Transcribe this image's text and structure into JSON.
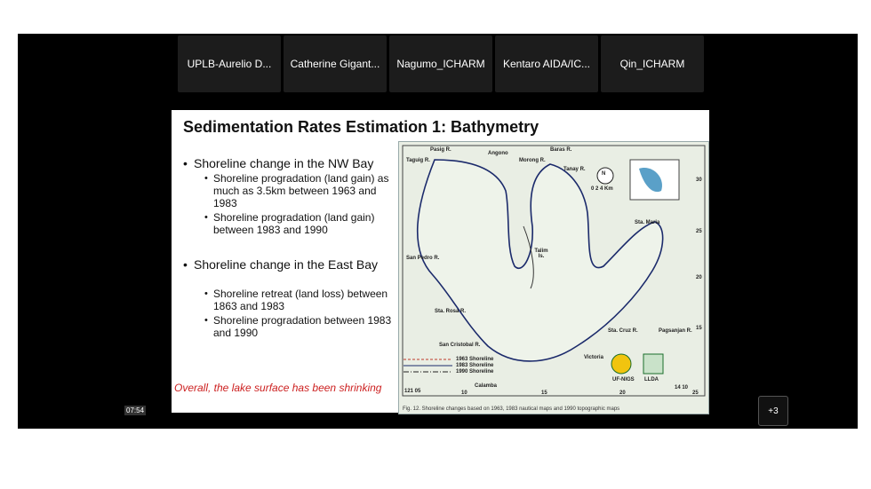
{
  "participants": [
    "UPLB-Aurelio D...",
    "Catherine Gigant...",
    "Nagumo_ICHARM",
    "Kentaro AIDA/IC...",
    "Qin_ICHARM"
  ],
  "slide": {
    "title": "Sedimentation Rates Estimation 1: Bathymetry",
    "nw_bay": "Shoreline change in the NW Bay",
    "nw_1": "Shoreline progradation (land gain) as much as 3.5km between 1963 and 1983",
    "nw_2": "Shoreline progradation (land gain) between 1983 and 1990",
    "east_bay": "Shoreline change in the East Bay",
    "east_1": "Shoreline retreat (land loss) between 1863 and 1983",
    "east_2": "Shoreline progradation between 1983 and 1990",
    "conclusion": "Overall, the lake surface has been shrinking",
    "map": {
      "caption": "Fig. 12. Shoreline changes based on 1963, 1983 nautical maps and 1990 topographic maps",
      "legend": [
        "1963 Shoreline",
        "1983 Shoreline",
        "1990 Shoreline"
      ],
      "labels": {
        "pasig": "Pasig R.",
        "taguig": "Taguig R.",
        "angono": "Angono",
        "morong": "Morong R.",
        "baras": "Baras R.",
        "tanay": "Tanay R.",
        "sta_maria": "Sta. Maria",
        "san_pedro": "San Pedro R.",
        "sta_rosa": "Sta. Rosa R.",
        "san_cristobal": "San Cristobal R.",
        "sta_cruz": "Sta. Cruz R.",
        "pagsanjan": "Pagsanjan R.",
        "victoria": "Victoria",
        "calamba": "Calamba",
        "talim": "Talim Is.",
        "north": "N",
        "scale": "0  2  4 Km",
        "ufnigs": "UF-NIGS",
        "llda": "LLDA",
        "left_coord": "121 05",
        "right_coord": "14 10",
        "x_ticks": [
          "10",
          "15",
          "20",
          "25"
        ],
        "y_ticks": [
          "30",
          "25",
          "20",
          "15"
        ]
      }
    }
  },
  "timer": "07:54",
  "more_count": "+3",
  "colors": {
    "background": "#000000",
    "tile": "#1c1c1c",
    "note": "#cc1f1f",
    "lake": "#e9eee4",
    "shore": "#1b2a6b"
  }
}
